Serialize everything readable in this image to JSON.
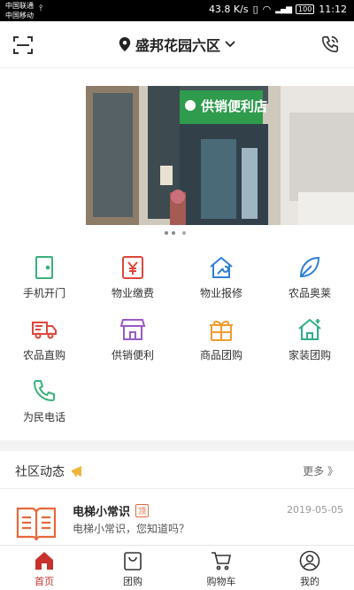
{
  "status_bar": {
    "carrier1": "中国联通",
    "carrier2": "中国移动",
    "speed": "43.8 K/s",
    "battery": "100",
    "time": "11:12"
  },
  "header": {
    "location": "盛邦花园六区"
  },
  "banner": {
    "store_sign": "供销便利店"
  },
  "services": [
    {
      "label": "手机开门",
      "icon": "door-icon",
      "color": "#3ab27a"
    },
    {
      "label": "物业缴费",
      "icon": "yen-icon",
      "color": "#e0463c"
    },
    {
      "label": "物业报修",
      "icon": "house-wrench-icon",
      "color": "#2f7fd6"
    },
    {
      "label": "农品奥莱",
      "icon": "leaf-icon",
      "color": "#2f7fd6"
    },
    {
      "label": "农品直购",
      "icon": "truck-icon",
      "color": "#e0463c"
    },
    {
      "label": "供销便利",
      "icon": "store-icon",
      "color": "#9b59c8"
    },
    {
      "label": "商品团购",
      "icon": "gift-icon",
      "color": "#f39c2d"
    },
    {
      "label": "家装团购",
      "icon": "home-icon",
      "color": "#2fae8a"
    },
    {
      "label": "为民电话",
      "icon": "phone-icon",
      "color": "#3ab27a"
    }
  ],
  "community": {
    "title": "社区动态",
    "more": "更多 》",
    "news": {
      "title": "电梯小常识",
      "badge": "顶",
      "date": "2019-05-05",
      "desc": "电梯小常识，您知道吗？"
    }
  },
  "tabbar": [
    {
      "label": "首页",
      "icon": "home-icon",
      "active": true
    },
    {
      "label": "团购",
      "icon": "bag-icon"
    },
    {
      "label": "购物车",
      "icon": "cart-icon"
    },
    {
      "label": "我的",
      "icon": "user-icon"
    }
  ],
  "colors": {
    "accent": "#c8312b",
    "book": "#e5693a"
  }
}
